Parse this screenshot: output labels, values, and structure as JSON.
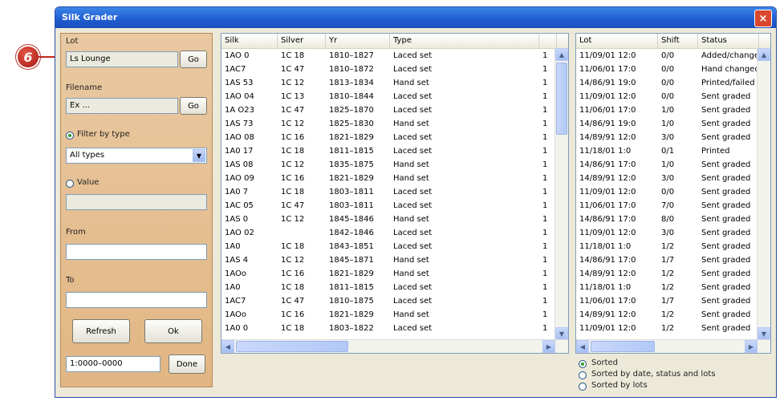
{
  "callout": {
    "number": "6"
  },
  "window": {
    "title": "Silk Grader",
    "close": "×"
  },
  "left": {
    "lot_label": "Lot",
    "lot_value": "Ls Lounge",
    "lot_btn": "Go",
    "filename_label": "Filename",
    "filename_value": "Ex ...",
    "filename_btn": "Go",
    "opt1_label": "Filter by type",
    "type_select": "All types",
    "opt2_label": "Value",
    "from_label": "From",
    "to_label": "To",
    "btn_refresh": "Refresh",
    "btn_ok": "Ok",
    "range_value": "1:0000–0000",
    "done_btn": "Done"
  },
  "grid1": {
    "headers": [
      "Silk",
      "Silver",
      "Yr",
      "Type"
    ],
    "rows": [
      [
        "1AO 0",
        "1C 18",
        "1810–1827",
        "Laced set",
        "1"
      ],
      [
        "1AC7",
        "1C 47",
        "1810–1872",
        "Laced set",
        "1"
      ],
      [
        "1AS 53",
        "1C 12",
        "1813–1834",
        "Hand set",
        "1"
      ],
      [
        "1AO 04",
        "1C 13",
        "1810–1844",
        "Laced set",
        "1"
      ],
      [
        "1A O23",
        "1C 47",
        "1825–1870",
        "Laced set",
        "1"
      ],
      [
        "1AS 73",
        "1C 12",
        "1825–1830",
        "Hand set",
        "1"
      ],
      [
        "1AO 08",
        "1C 16",
        "1821–1829",
        "Laced set",
        "1"
      ],
      [
        "1A0 17",
        "1C 18",
        "1811–1815",
        "Laced set",
        "1"
      ],
      [
        "1AS 08",
        "1C 12",
        "1835–1875",
        "Hand set",
        "1"
      ],
      [
        "1AO 09",
        "1C 16",
        "1821–1829",
        "Hand set",
        "1"
      ],
      [
        "1A0 7",
        "1C 18",
        "1803–1811",
        "Laced set",
        "1"
      ],
      [
        "1AC 05",
        "1C 47",
        "1803–1811",
        "Laced set",
        "1"
      ],
      [
        "1AS 0",
        "1C 12",
        "1845–1846",
        "Hand set",
        "1"
      ],
      [
        "1AO 02",
        "",
        "1842–1846",
        "Laced set",
        "1"
      ],
      [
        "1A0",
        "1C 18",
        "1843–1851",
        "Laced set",
        "1"
      ],
      [
        "1AS 4",
        "1C 12",
        "1845–1871",
        "Hand set",
        "1"
      ],
      [
        "1AOo",
        "1C 16",
        "1821–1829",
        "Hand set",
        "1"
      ],
      [
        "1A0",
        "1C 18",
        "1811–1815",
        "Laced set",
        "1"
      ],
      [
        "1AC7",
        "1C 47",
        "1810–1875",
        "Laced set",
        "1"
      ],
      [
        "1AOo",
        "1C 16",
        "1821–1829",
        "Hand set",
        "1"
      ],
      [
        "1A0 0",
        "1C 18",
        "1803–1822",
        "Laced set",
        "1"
      ]
    ]
  },
  "grid2": {
    "headers": [
      "Lot",
      "Shift",
      "Status"
    ],
    "rows": [
      [
        "11/09/01 12:0",
        "0/0",
        "Added/changed"
      ],
      [
        "11/06/01 17:0",
        "0/0",
        "Hand changed"
      ],
      [
        "14/86/91 19:0",
        "0/0",
        "Printed/failed"
      ],
      [
        "11/09/01 12:0",
        "0/0",
        "Sent graded"
      ],
      [
        "11/06/01 17:0",
        "1/0",
        "Sent graded"
      ],
      [
        "14/86/91 19:0",
        "1/0",
        "Sent graded"
      ],
      [
        "14/89/91 12:0",
        "3/0",
        "Sent graded"
      ],
      [
        "11/18/01 1:0",
        "0/1",
        "Printed"
      ],
      [
        "14/86/91 17:0",
        "1/0",
        "Sent graded"
      ],
      [
        "14/89/91 12:0",
        "3/0",
        "Sent graded"
      ],
      [
        "11/09/01 12:0",
        "0/0",
        "Sent graded"
      ],
      [
        "11/06/01 17:0",
        "7/0",
        "Sent graded"
      ],
      [
        "14/86/91 17:0",
        "8/0",
        "Sent graded"
      ],
      [
        "11/09/01 12:0",
        "3/0",
        "Sent graded"
      ],
      [
        "11/18/01 1:0",
        "1/2",
        "Sent graded"
      ],
      [
        "14/86/91 17:0",
        "1/7",
        "Sent graded"
      ],
      [
        "14/89/91 12:0",
        "1/2",
        "Sent graded"
      ],
      [
        "11/18/01 1:0",
        "1/2",
        "Sent graded"
      ],
      [
        "11/06/01 17:0",
        "1/7",
        "Sent graded"
      ],
      [
        "14/89/91 12:0",
        "1/2",
        "Sent graded"
      ],
      [
        "11/09/01 12:0",
        "1/2",
        "Sent graded"
      ]
    ]
  },
  "bottom": {
    "radio1": "Sorted",
    "radio2": "Sorted by date, status and lots",
    "radio3": "Sorted by lots"
  }
}
